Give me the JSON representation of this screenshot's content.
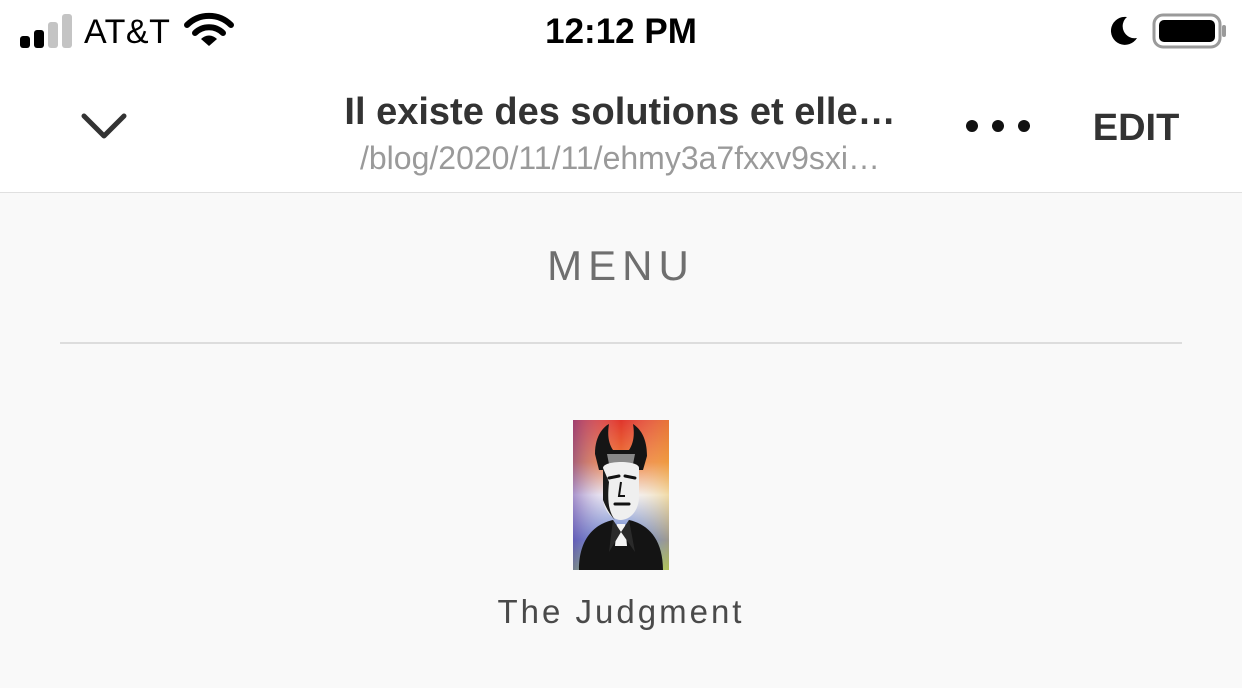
{
  "status_bar": {
    "carrier": "AT&T",
    "time": "12:12 PM",
    "signal_bars_active": 2,
    "signal_bars_total": 4,
    "battery_level": 1.0,
    "do_not_disturb": true
  },
  "nav": {
    "title": "Il existe des solutions et elle…",
    "url": "/blog/2020/11/11/ehmy3a7fxxv9sxi…",
    "edit_label": "EDIT",
    "back_icon": "chevron-down-icon",
    "more_icon": "more-dots-icon"
  },
  "content": {
    "menu_label": "MENU",
    "artwork": {
      "caption": "The Judgment"
    }
  },
  "colors": {
    "text_primary": "#333333",
    "text_muted": "#9a9a9a",
    "menu_text": "#6f6f6f",
    "content_background": "#f9f9f9",
    "divider": "#dddddd"
  }
}
